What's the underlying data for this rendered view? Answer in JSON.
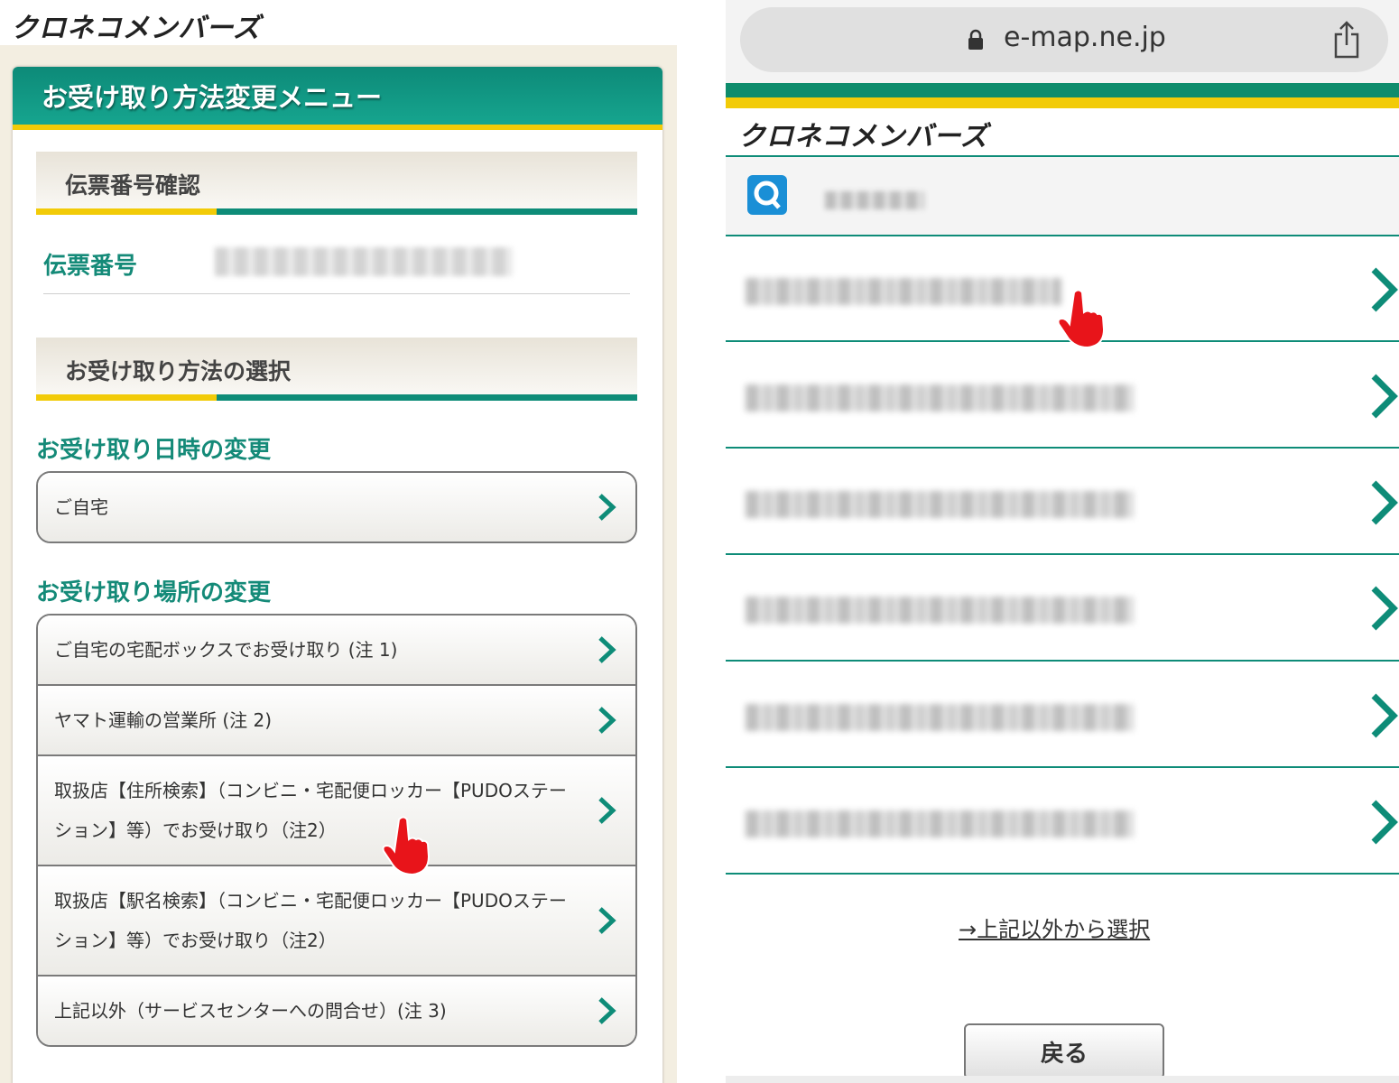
{
  "left": {
    "logo": "クロネコメンバーズ",
    "menu_title": "お受け取り方法変更メニュー",
    "section_slip": "伝票番号確認",
    "slip_label": "伝票番号",
    "section_method": "お受け取り方法の選択",
    "datetime_title": "お受け取り日時の変更",
    "datetime_options": [
      "ご自宅"
    ],
    "place_title": "お受け取り場所の変更",
    "place_options": [
      "ご自宅の宅配ボックスでお受け取り (注 1)",
      "ヤマト運輸の営業所 (注 2)",
      "取扱店【住所検索】（コンビニ・宅配便ロッカー【PUDOステーション】等）でお受け取り（注2）",
      "取扱店【駅名検索】（コンビニ・宅配便ロッカー【PUDOステーション】等）でお受け取り（注2）",
      "上記以外（サービスセンターへの問合せ）(注 3)"
    ]
  },
  "right": {
    "url": "e-map.ne.jp",
    "logo": "クロネコメンバーズ",
    "other_link": "→上記以外から選択",
    "back_button": "戻る"
  },
  "icons": {
    "lock": "lock-icon",
    "share": "share-icon",
    "search": "search-icon",
    "chevron": "chevron-right-icon",
    "pointer": "pointing-hand-icon"
  },
  "colors": {
    "brand_green": "#0e8c78",
    "brand_yellow": "#f2cb08",
    "pointer_red": "#e8141a"
  }
}
